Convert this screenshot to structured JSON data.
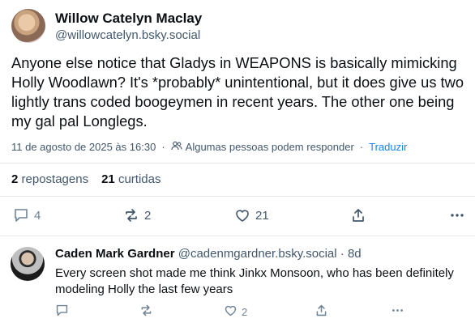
{
  "post": {
    "author_name": "Willow Catelyn Maclay",
    "author_handle": "@willowcatelyn.bsky.social",
    "text": "Anyone else notice that Gladys in WEAPONS is basically mimicking Holly Woodlawn? It's *probably* unintentional, but it does give us two lightly trans coded boogeymen in recent years. The other one being my gal pal Longlegs.",
    "timestamp": "11 de agosto de 2025 às 16:30",
    "reply_restriction": "Algumas pessoas podem responder",
    "translate_label": "Traduzir",
    "reposts_count": "2",
    "reposts_label": "repostagens",
    "likes_count": "21",
    "likes_label": "curtidas",
    "actions": {
      "reply_count": "4",
      "repost_count": "2",
      "like_count": "21"
    }
  },
  "reply": {
    "author_name": "Caden Mark Gardner",
    "author_handle": "@cadenmgardner.bsky.social",
    "time_ago": "8d",
    "text": "Every screen shot made me think Jinkx Monsoon, who has been definitely modeling Holly the last few years",
    "actions": {
      "like_count": "2"
    }
  },
  "colors": {
    "text_primary": "#0b0f14",
    "text_secondary": "#42576c",
    "icon_muted": "#6f8396",
    "link": "#1083fe",
    "divider": "#e4e8ec"
  },
  "icons": [
    "reply-icon",
    "repost-icon",
    "like-icon",
    "share-icon",
    "more-icon",
    "globe-people-icon"
  ]
}
